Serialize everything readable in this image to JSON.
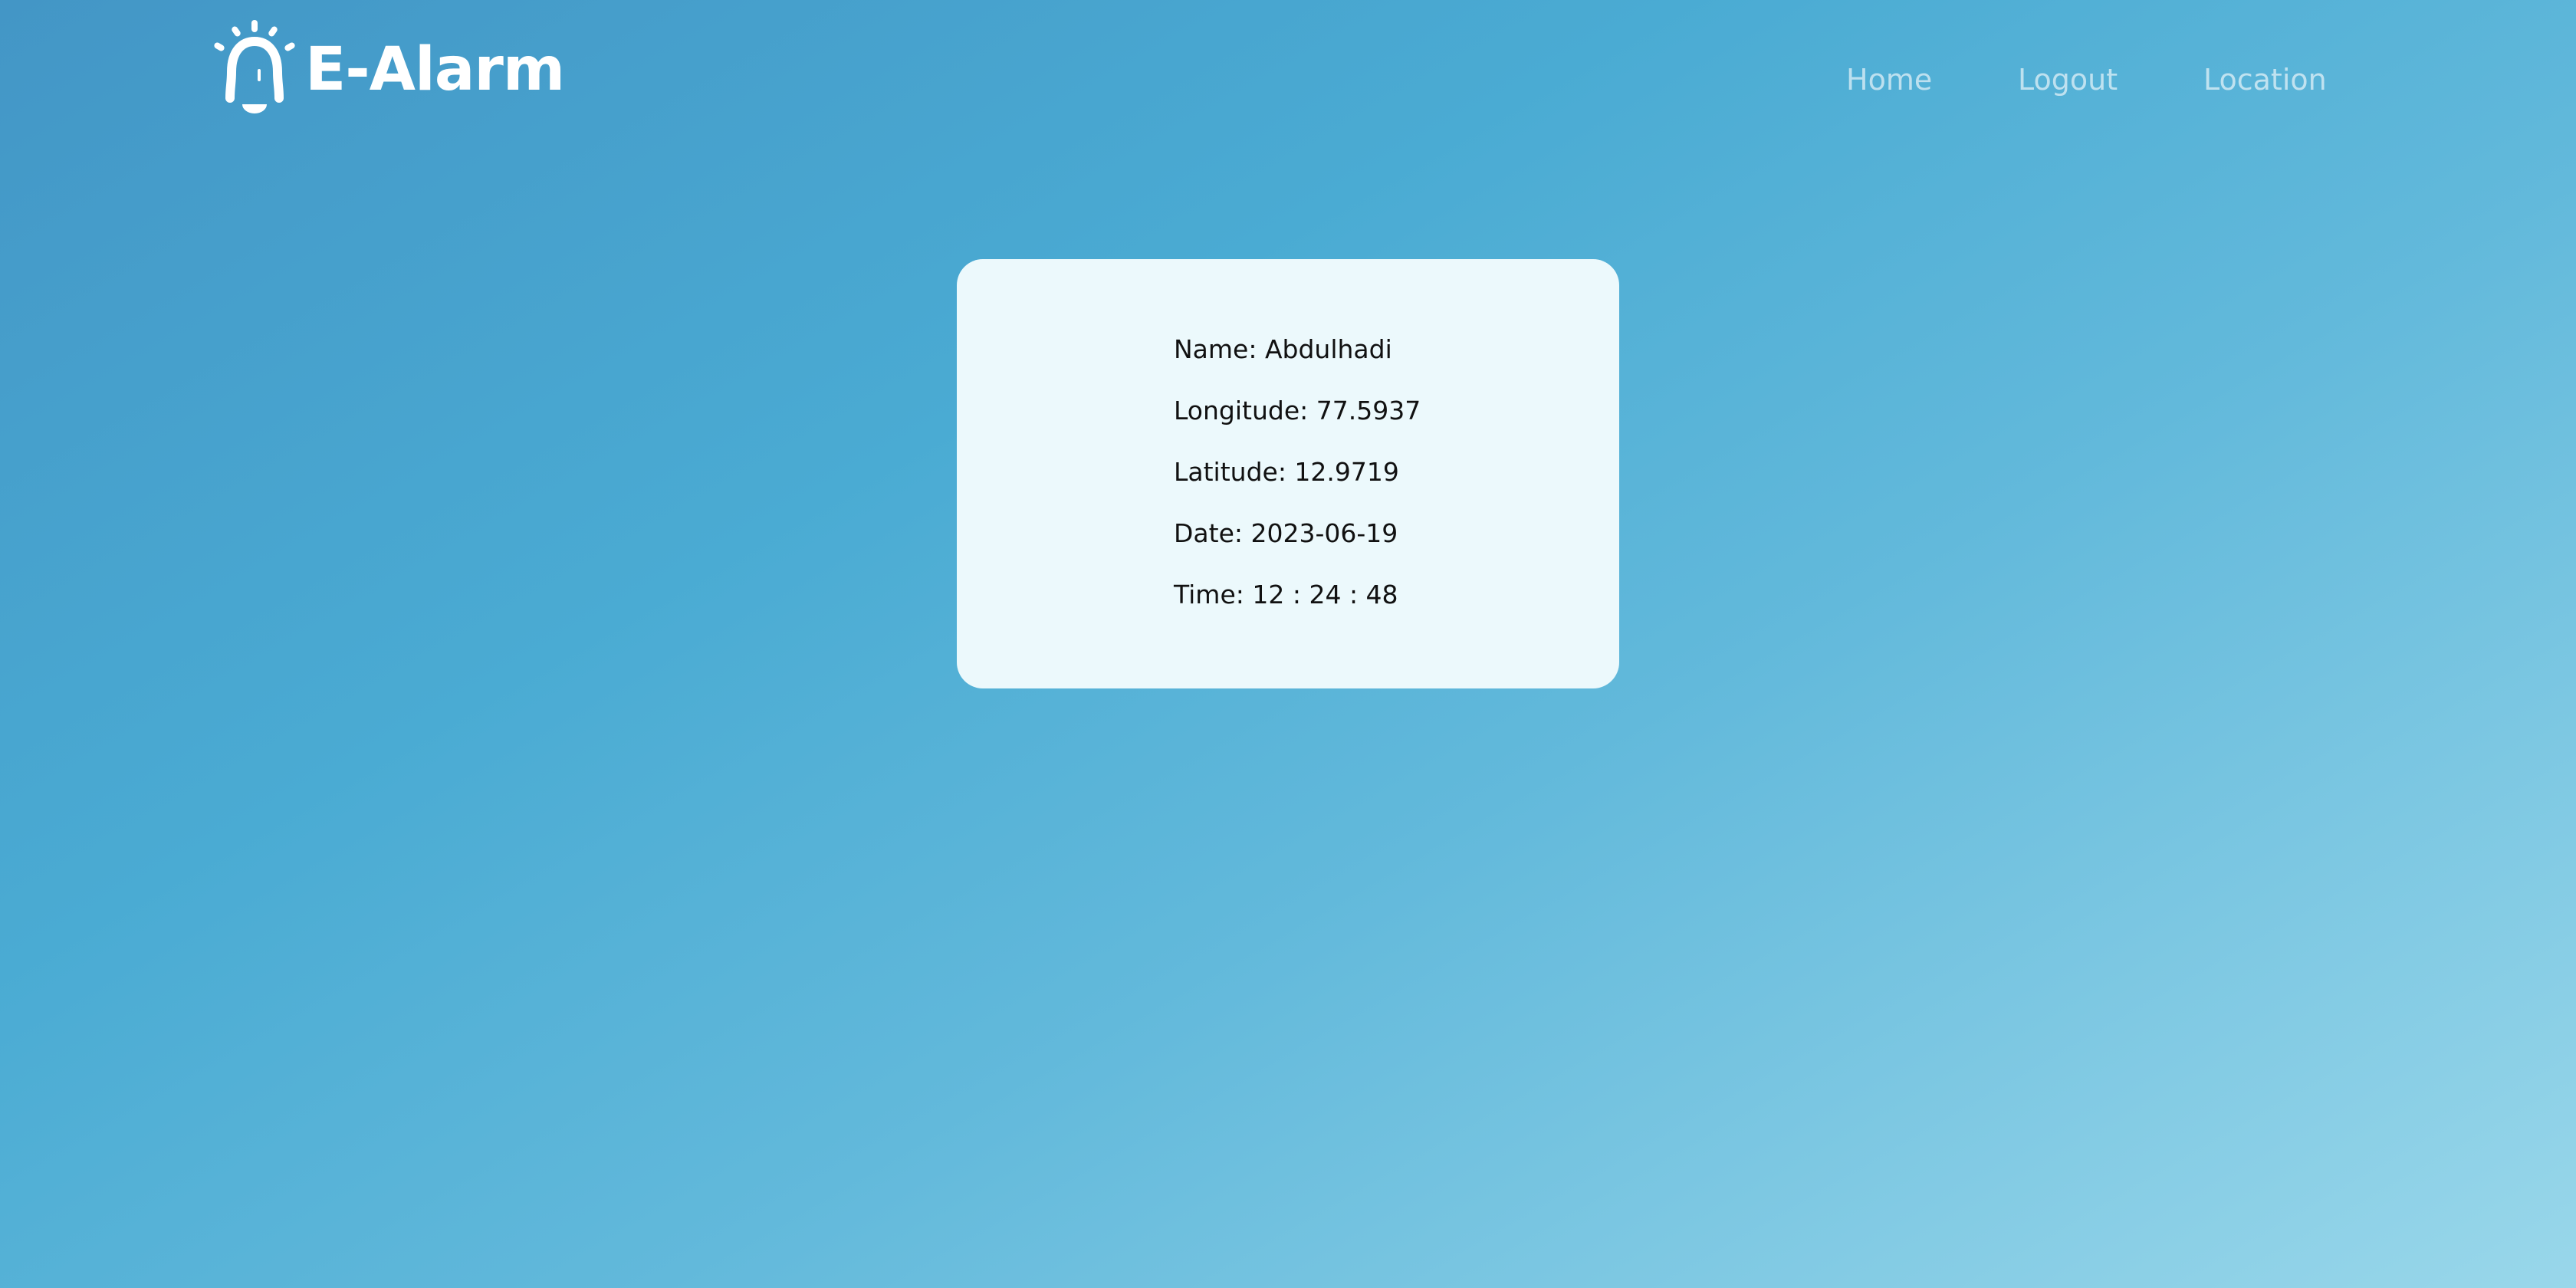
{
  "header": {
    "brand": "E-Alarm",
    "brand_icon": "bell-alarm-icon",
    "nav": {
      "home": "Home",
      "logout": "Logout",
      "location": "Location"
    }
  },
  "details": {
    "name": "Name: Abdulhadi",
    "longitude": "Longitude: 77.5937",
    "latitude": "Latitude: 12.9719",
    "date": "Date: 2023-06-19",
    "time": "Time: 12 : 24 : 48"
  },
  "colors": {
    "background_start": "#4396c6",
    "background_end": "#99d7ea",
    "card": "#ecf9fc",
    "text": "#111111",
    "brand": "#ffffff"
  }
}
